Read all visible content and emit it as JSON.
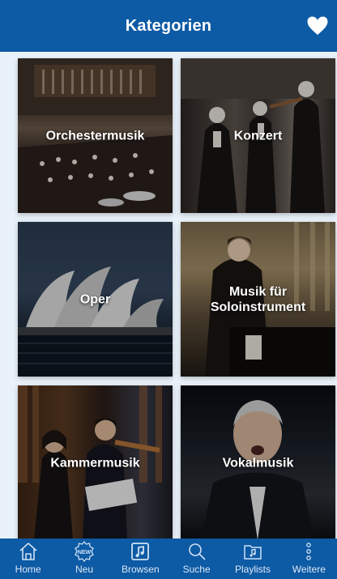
{
  "header": {
    "title": "Kategorien",
    "favorite_icon": "heart-icon"
  },
  "categories": [
    {
      "label": "Orchestermusik"
    },
    {
      "label": "Konzert"
    },
    {
      "label": "Oper"
    },
    {
      "label": "Musik für Soloinstrument"
    },
    {
      "label": "Kammermusik"
    },
    {
      "label": "Vokalmusik"
    }
  ],
  "tabs": [
    {
      "label": "Home",
      "icon": "home-icon"
    },
    {
      "label": "Neu",
      "icon": "new-badge-icon"
    },
    {
      "label": "Browsen",
      "icon": "music-note-icon"
    },
    {
      "label": "Suche",
      "icon": "search-icon"
    },
    {
      "label": "Playlists",
      "icon": "playlist-icon"
    },
    {
      "label": "Weitere",
      "icon": "more-icon"
    }
  ],
  "colors": {
    "brand_blue": "#0d5aa5",
    "background": "#e6f0f8",
    "tab_label": "#dbe8f5"
  }
}
